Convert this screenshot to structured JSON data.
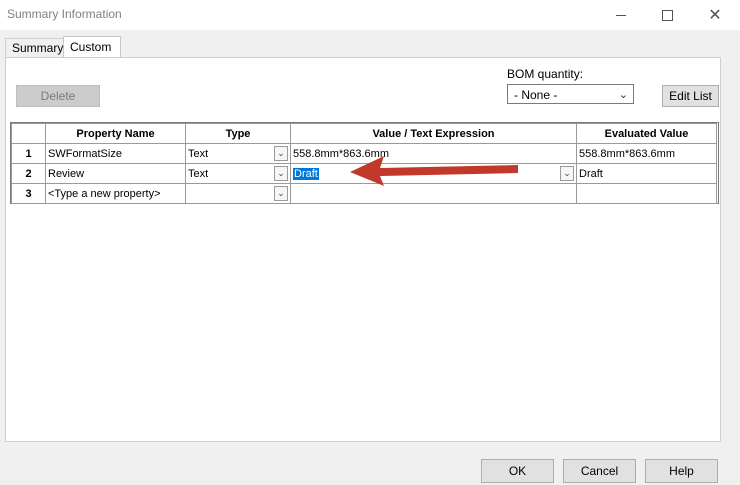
{
  "window": {
    "title": "Summary Information",
    "minimize_glyph": "–",
    "close_glyph": "✕"
  },
  "tabs": [
    {
      "label": "Summary",
      "selected": false
    },
    {
      "label": "Custom",
      "selected": true
    }
  ],
  "toolbar": {
    "delete_label": "Delete",
    "bom_label": "BOM quantity:",
    "bom_value": "- None -",
    "edit_list_label": "Edit List"
  },
  "grid": {
    "columns": [
      "",
      "Property Name",
      "Type",
      "Value / Text Expression",
      "Evaluated Value"
    ],
    "rows": [
      {
        "num": "1",
        "name": "SWFormatSize",
        "type": "Text",
        "value": "558.8mm*863.6mm",
        "evaluated": "558.8mm*863.6mm"
      },
      {
        "num": "2",
        "name": "Review",
        "type": "Text",
        "value": "Draft",
        "evaluated": "Draft"
      },
      {
        "num": "3",
        "name": "<Type a new property>",
        "type": "",
        "value": "",
        "evaluated": ""
      }
    ]
  },
  "footer": {
    "ok_label": "OK",
    "cancel_label": "Cancel",
    "help_label": "Help"
  },
  "colors": {
    "annotation_arrow": "#c0392b",
    "selection": "#0078d7"
  },
  "icons": {
    "dropdown": "chevron-down-icon"
  }
}
